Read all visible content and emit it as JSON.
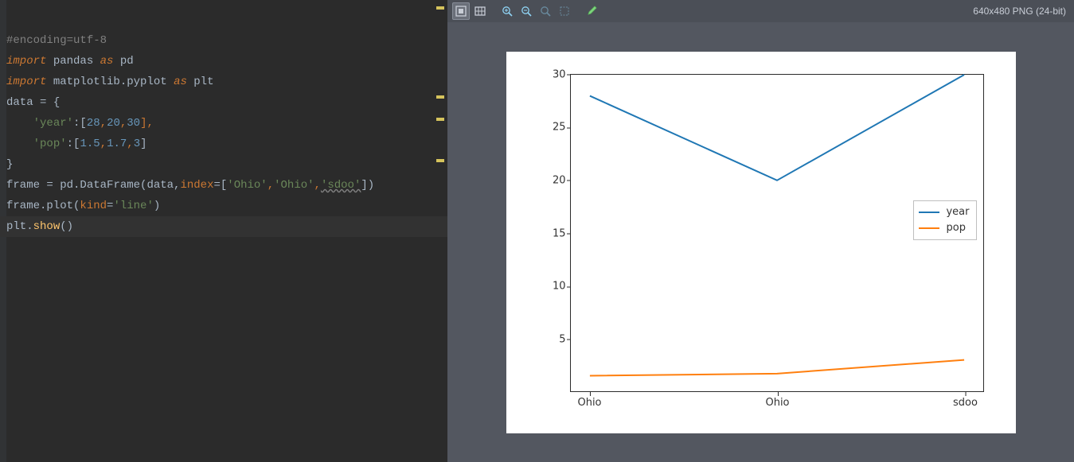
{
  "editor": {
    "lines": {
      "l1_comment": "#encoding=utf-8",
      "l2_import": "import",
      "l2_mod": " pandas ",
      "l2_as": "as",
      "l2_alias": " pd",
      "l3_import": "import",
      "l3_mod": " matplotlib.pyplot ",
      "l3_as": "as",
      "l3_alias": " plt",
      "l4_a": "data ",
      "l4_eq": "=",
      "l4_b": " {",
      "l5_indent": "    ",
      "l5_key": "'year'",
      "l5_sep": ":[",
      "l5_v1": "28",
      "l5_c1": ",",
      "l5_v2": "20",
      "l5_c2": ",",
      "l5_v3": "30",
      "l5_end": "],",
      "l6_indent": "    ",
      "l6_key": "'pop'",
      "l6_sep": ":[",
      "l6_v1": "1.5",
      "l6_c1": ",",
      "l6_v2": "1.7",
      "l6_c2": ",",
      "l6_v3": "3",
      "l6_end": "]",
      "l7": "}",
      "l8_a": "frame ",
      "l8_eq": "=",
      "l8_b": " pd.DataFrame(data,",
      "l8_kw": "index",
      "l8_c": "=[",
      "l8_s1": "'Ohio'",
      "l8_cm1": ",",
      "l8_s2": "'Ohio'",
      "l8_cm2": ",",
      "l8_s3": "'sdoo'",
      "l8_d": "])",
      "l9_a": "frame.plot(",
      "l9_kw": "kind",
      "l9_b": "=",
      "l9_s": "'line'",
      "l9_c": ")",
      "l10_a": "plt.",
      "l10_fn": "show",
      "l10_b": "()"
    }
  },
  "viewer": {
    "info": "640x480 PNG (24-bit)"
  },
  "chart_data": {
    "type": "line",
    "categories": [
      "Ohio",
      "Ohio",
      "sdoo"
    ],
    "series": [
      {
        "name": "year",
        "values": [
          28,
          20,
          30
        ],
        "color": "#1f77b4"
      },
      {
        "name": "pop",
        "values": [
          1.5,
          1.7,
          3
        ],
        "color": "#ff7f0e"
      }
    ],
    "ylim": [
      0,
      30
    ],
    "yticks": [
      5,
      10,
      15,
      20,
      25,
      30
    ],
    "xlabel": "",
    "ylabel": "",
    "title": "",
    "legend_position": "right"
  }
}
